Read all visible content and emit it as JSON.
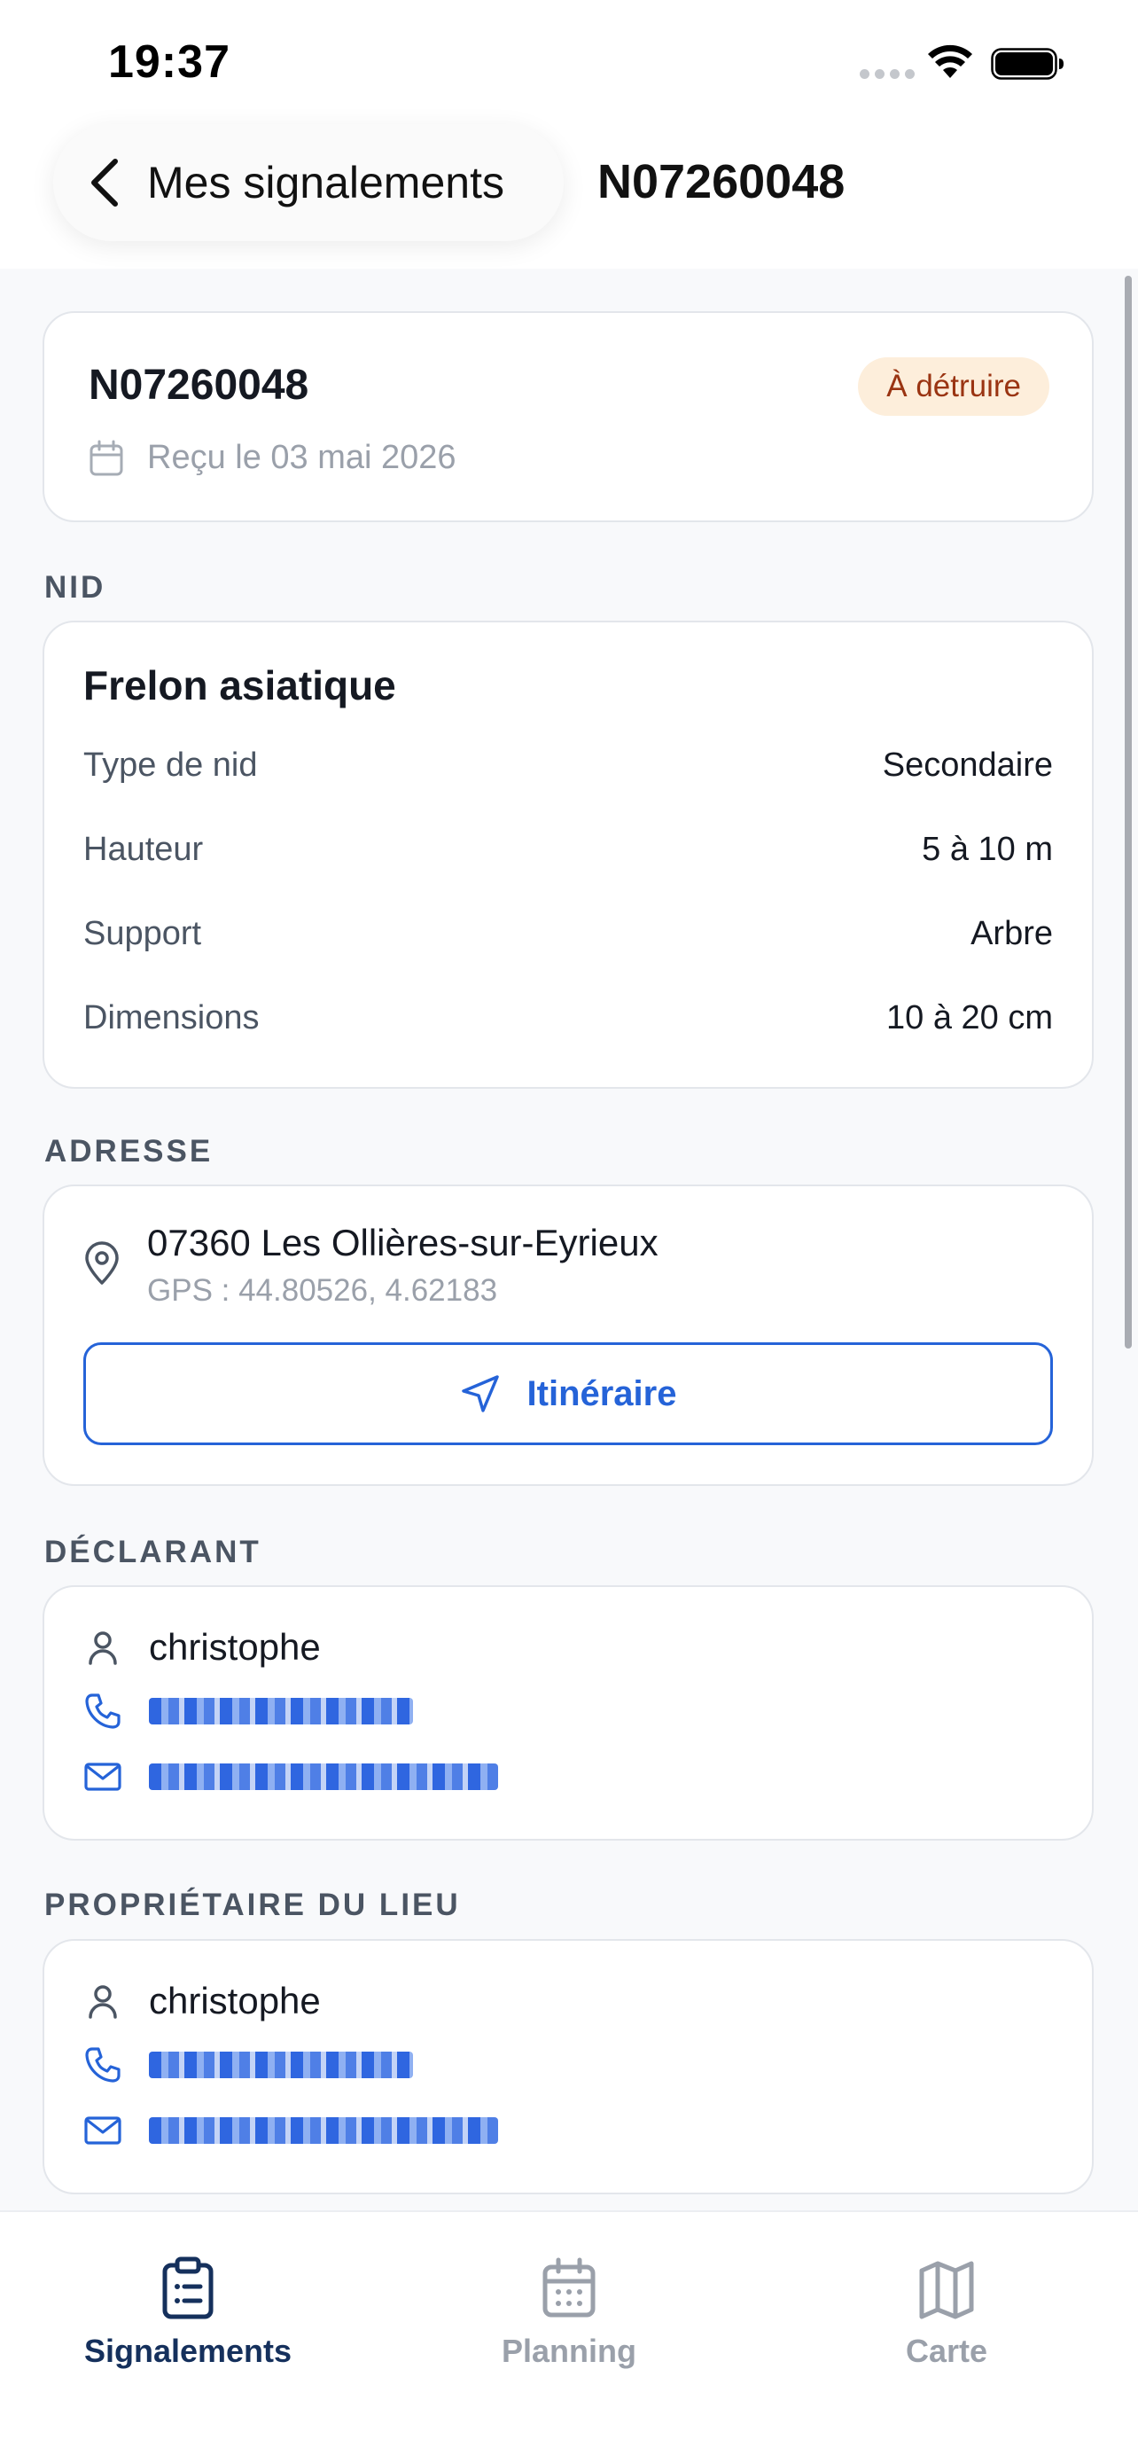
{
  "status_bar": {
    "time": "19:37"
  },
  "nav": {
    "back_label": "Mes signalements",
    "title": "N07260048"
  },
  "header_card": {
    "report_id": "N07260048",
    "status": "À détruire",
    "received": "Reçu le 03 mai 2026"
  },
  "nest_section": {
    "label": "NID",
    "species": "Frelon asiatique",
    "rows": [
      {
        "key": "Type de nid",
        "value": "Secondaire"
      },
      {
        "key": "Hauteur",
        "value": "5 à 10 m"
      },
      {
        "key": "Support",
        "value": "Arbre"
      },
      {
        "key": "Dimensions",
        "value": "10 à 20 cm"
      }
    ]
  },
  "address_section": {
    "label": "ADRESSE",
    "address": "07360 Les Ollières-sur-Eyrieux",
    "gps": "GPS : 44.80526, 4.62183",
    "route_label": "Itinéraire"
  },
  "declarant_section": {
    "label": "DÉCLARANT",
    "name": "christophe"
  },
  "owner_section": {
    "label": "PROPRIÉTAIRE DU LIEU",
    "name": "christophe"
  },
  "tabs": [
    {
      "label": "Signalements",
      "icon": "clipboard-list-icon",
      "active": true
    },
    {
      "label": "Planning",
      "icon": "calendar-icon",
      "active": false
    },
    {
      "label": "Carte",
      "icon": "map-icon",
      "active": false
    }
  ],
  "colors": {
    "accent": "#2563d8",
    "tab_active": "#15305c",
    "tab_inactive": "#9aa0aa",
    "badge_bg": "#fdeedb",
    "badge_text": "#9a3412"
  }
}
